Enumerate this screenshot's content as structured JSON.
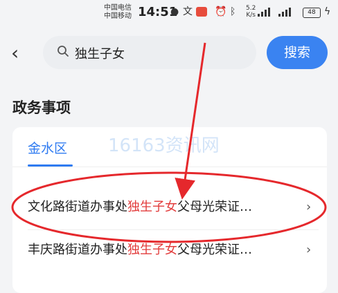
{
  "status_bar": {
    "carrier_1": "中国电信",
    "carrier_2": "中国移动",
    "time": "14:51",
    "net_speed_value": "5.2",
    "net_speed_unit": "K/s",
    "battery": "48"
  },
  "search": {
    "query": "独生子女",
    "button_label": "搜索"
  },
  "section": {
    "title": "政务事项",
    "tab_label": "金水区",
    "watermark": "16163资讯网"
  },
  "results": [
    {
      "prefix": "文化路街道办事处",
      "highlight": "独生子女",
      "suffix": "父母光荣证…"
    },
    {
      "prefix": "丰庆路街道办事处",
      "highlight": "独生子女",
      "suffix": "父母光荣证…"
    }
  ],
  "colors": {
    "accent": "#3a83f1",
    "highlight": "#e23c3c",
    "annotation": "#e5282c"
  }
}
